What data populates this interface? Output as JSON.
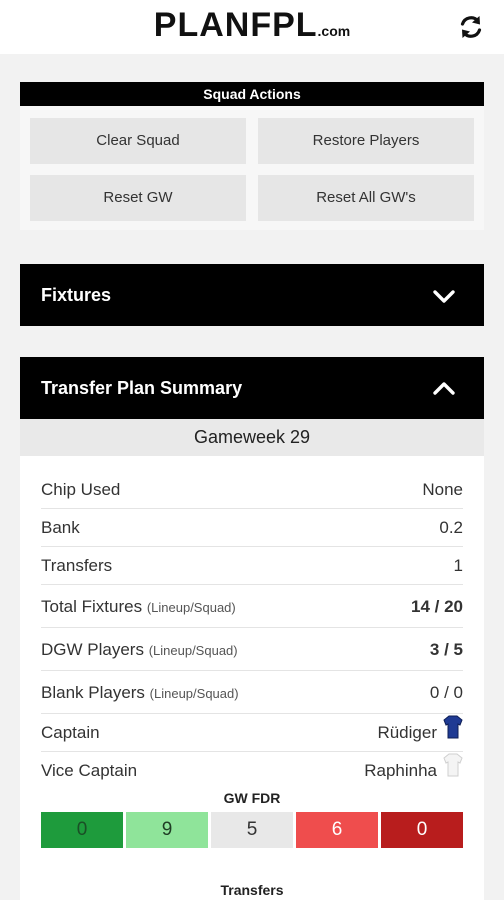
{
  "header": {
    "logo_main": "PLANFPL",
    "logo_suffix": ".com",
    "refresh_icon": "refresh-icon"
  },
  "squad_actions": {
    "title": "Squad Actions",
    "buttons": {
      "clear": "Clear Squad",
      "restore": "Restore Players",
      "reset_gw": "Reset GW",
      "reset_all": "Reset All GW's"
    }
  },
  "fixtures": {
    "title": "Fixtures",
    "icon": "chevron-down-icon"
  },
  "transfer_summary": {
    "title": "Transfer Plan Summary",
    "icon": "chevron-up-icon",
    "gameweek": "Gameweek 29",
    "rows": {
      "chip": {
        "label": "Chip Used",
        "value": "None"
      },
      "bank": {
        "label": "Bank",
        "value": "0.2"
      },
      "transfers": {
        "label": "Transfers",
        "value": "1"
      },
      "total_fixtures": {
        "label": "Total Fixtures",
        "sub": "(Lineup/Squad)",
        "value": "14 / 20"
      },
      "dgw_players": {
        "label": "DGW Players",
        "sub": "(Lineup/Squad)",
        "value": "3 / 5"
      },
      "blank_players": {
        "label": "Blank Players",
        "sub": "(Lineup/Squad)",
        "value": "0 / 0"
      },
      "captain": {
        "label": "Captain",
        "value": "Rüdiger",
        "shirt_color": "#1f3a93"
      },
      "vice_captain": {
        "label": "Vice Captain",
        "value": "Raphinha",
        "shirt_color": "#f4f4f4"
      }
    },
    "gw_fdr": {
      "title": "GW FDR",
      "cells": [
        {
          "value": "0",
          "bg": "#1e9b3c",
          "fg": "#1a4f26"
        },
        {
          "value": "9",
          "bg": "#8fe49a",
          "fg": "#1f3d24"
        },
        {
          "value": "5",
          "bg": "#e8e8e8",
          "fg": "#333333"
        },
        {
          "value": "6",
          "bg": "#ef4d4d",
          "fg": "#ffffff"
        },
        {
          "value": "0",
          "bg": "#b81d1d",
          "fg": "#ffffff"
        }
      ]
    },
    "transfers_title": "Transfers"
  },
  "colors": {
    "accent_green": "#2e9e44",
    "header_black": "#000000"
  }
}
